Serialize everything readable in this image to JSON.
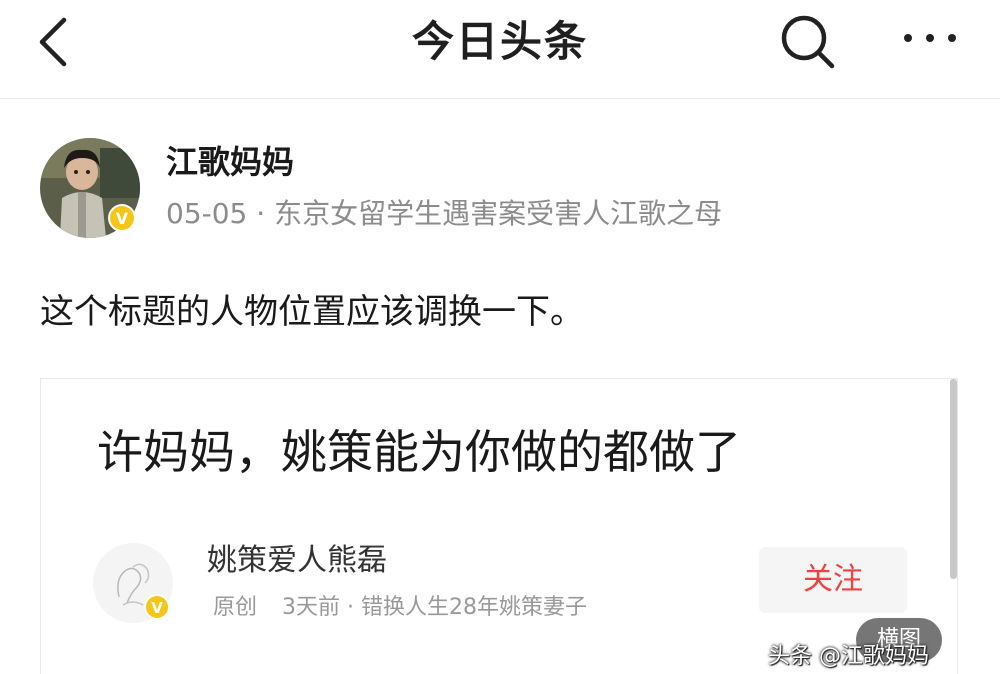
{
  "header": {
    "title": "今日头条",
    "back_icon": "chevron-left-icon",
    "search_icon": "search-icon",
    "more_icon": "more-dots-icon"
  },
  "author": {
    "name": "江歌妈妈",
    "date": "05-05",
    "separator": "·",
    "description": "东京女留学生遇害案受害人江歌之母",
    "verified_badge": "V",
    "badge_color": "#f5c518"
  },
  "post": {
    "text": "这个标题的人物位置应该调换一下。"
  },
  "shared_card": {
    "title": "许妈妈，姚策能为你做的都做了",
    "author_name": "姚策爱人熊磊",
    "original_label": "原创",
    "time": "3天前",
    "separator": "·",
    "author_desc": "错换人生28年姚策妻子",
    "follow_label": "关注",
    "follow_color": "#f04142",
    "verified_badge": "V"
  },
  "overlay": {
    "landscape_label": "横图",
    "watermark": "头条 @江歌妈妈"
  }
}
